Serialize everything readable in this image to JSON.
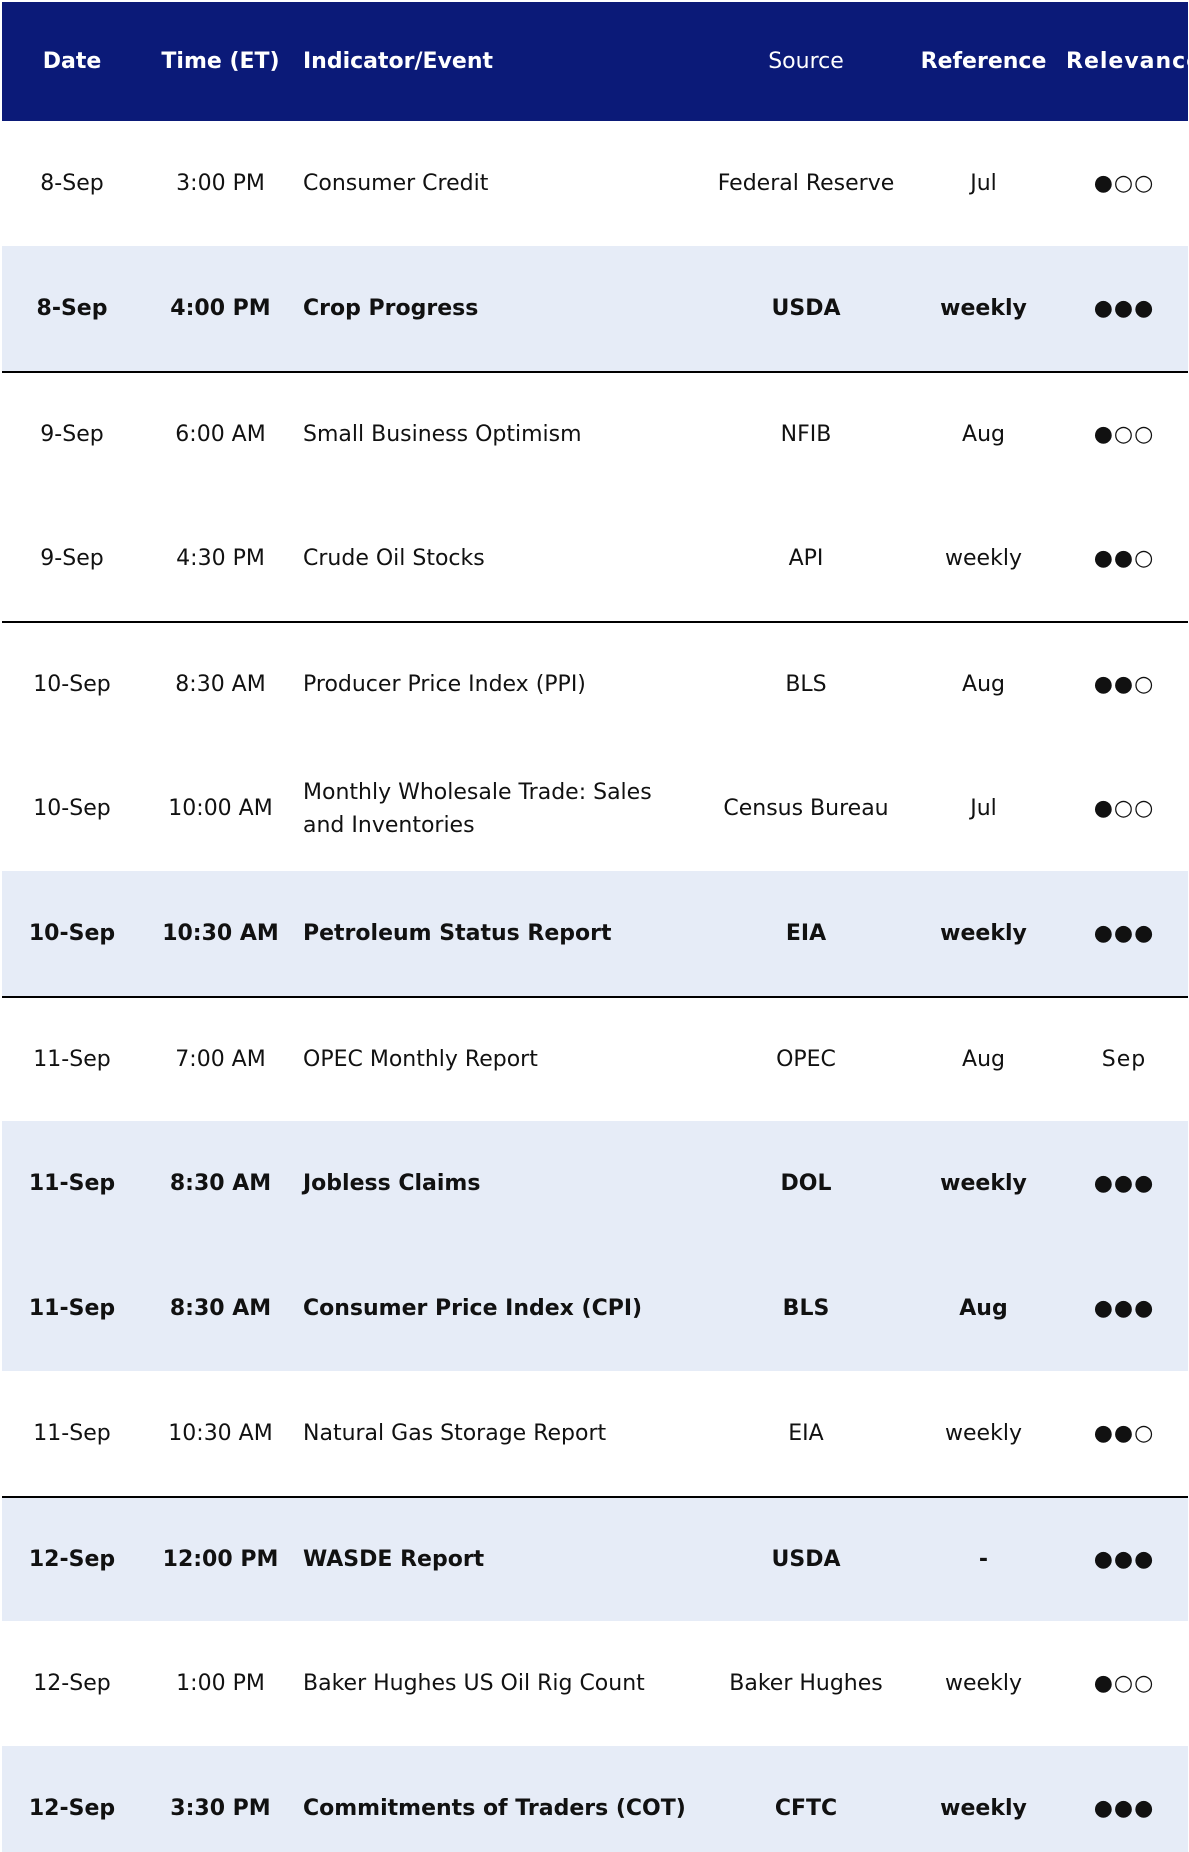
{
  "header": {
    "date": "Date",
    "time": "Time (ET)",
    "indicator": "Indicator/Event",
    "source": "Source",
    "reference": "Reference",
    "relevance": "Relevance"
  },
  "colors": {
    "header_bg": "#0b1a78",
    "highlight_bg": "#e6ecf7"
  },
  "rows": [
    {
      "date": "8-Sep",
      "time": "3:00 PM",
      "indicator": "Consumer Credit",
      "source": "Federal Reserve",
      "reference": "Jul",
      "relevance": "●○○",
      "highlight": false
    },
    {
      "date": "8-Sep",
      "time": "4:00 PM",
      "indicator": "Crop Progress",
      "source": "USDA",
      "reference": "weekly",
      "relevance": "●●●",
      "highlight": true
    },
    {
      "date": "9-Sep",
      "time": "6:00 AM",
      "indicator": "Small Business Optimism",
      "source": "NFIB",
      "reference": "Aug",
      "relevance": "●○○",
      "highlight": false
    },
    {
      "date": "9-Sep",
      "time": "4:30 PM",
      "indicator": "Crude Oil Stocks",
      "source": "API",
      "reference": "weekly",
      "relevance": "●●○",
      "highlight": false
    },
    {
      "date": "10-Sep",
      "time": "8:30 AM",
      "indicator": "Producer Price Index (PPI)",
      "source": "BLS",
      "reference": "Aug",
      "relevance": "●●○",
      "highlight": false
    },
    {
      "date": "10-Sep",
      "time": "10:00 AM",
      "indicator": "Monthly Wholesale Trade: Sales and Inventories",
      "source": "Census Bureau",
      "reference": "Jul",
      "relevance": "●○○",
      "highlight": false
    },
    {
      "date": "10-Sep",
      "time": "10:30 AM",
      "indicator": "Petroleum Status Report",
      "source": "EIA",
      "reference": "weekly",
      "relevance": "●●●",
      "highlight": true
    },
    {
      "date": "11-Sep",
      "time": "7:00 AM",
      "indicator": "OPEC Monthly Report",
      "source": "OPEC",
      "reference": "Aug",
      "relevance": "Sep",
      "highlight": false
    },
    {
      "date": "11-Sep",
      "time": "8:30 AM",
      "indicator": "Jobless Claims",
      "source": "DOL",
      "reference": "weekly",
      "relevance": "●●●",
      "highlight": true
    },
    {
      "date": "11-Sep",
      "time": "8:30 AM",
      "indicator": "Consumer Price Index (CPI)",
      "source": "BLS",
      "reference": "Aug",
      "relevance": "●●●",
      "highlight": true
    },
    {
      "date": "11-Sep",
      "time": "10:30 AM",
      "indicator": "Natural Gas Storage Report",
      "source": "EIA",
      "reference": "weekly",
      "relevance": "●●○",
      "highlight": false
    },
    {
      "date": "12-Sep",
      "time": "12:00 PM",
      "indicator": "WASDE Report",
      "source": "USDA",
      "reference": "-",
      "relevance": "●●●",
      "highlight": true
    },
    {
      "date": "12-Sep",
      "time": "1:00 PM",
      "indicator": "Baker Hughes US Oil Rig Count",
      "source": "Baker Hughes",
      "reference": "weekly",
      "relevance": "●○○",
      "highlight": false
    },
    {
      "date": "12-Sep",
      "time": "3:30 PM",
      "indicator": "Commitments of Traders (COT)",
      "source": "CFTC",
      "reference": "weekly",
      "relevance": "●●●",
      "highlight": true
    }
  ]
}
